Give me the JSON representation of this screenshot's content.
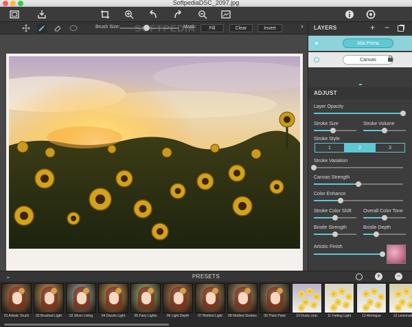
{
  "window": {
    "title": "SoftpediaDSC_2097.jpg",
    "traffic_colors": [
      "#fc605c",
      "#fdbc40",
      "#34c84a"
    ]
  },
  "toolbar": {
    "icons": [
      "open-image-icon",
      "import-icon",
      "crop-icon",
      "zoom-in-icon",
      "undo-icon",
      "redo-icon",
      "zoom-out-icon",
      "fit-screen-icon",
      "info-icon",
      "settings-icon"
    ]
  },
  "subbar": {
    "brush_size_label": "Brush Size:",
    "brush_size_value": 0.45,
    "mask_label": "Mask:",
    "fill_label": "Fill",
    "clear_label": "Clear",
    "invert_label": "Invert",
    "collapse_label": "›"
  },
  "watermark": "SOFTPEDIA",
  "layers": {
    "title": "LAYERS",
    "add_label": "+",
    "remove_label": "−",
    "items": [
      {
        "name": "Alla Prima",
        "selected": true
      },
      {
        "name": "Canvas",
        "selected": false,
        "locked": true
      }
    ]
  },
  "adjust": {
    "title": "ADJUST",
    "layer_opacity": {
      "label": "Layer Opacity",
      "value": 1.0
    },
    "stroke_size": {
      "label": "Stroke Size",
      "value": 0.45
    },
    "stroke_volume": {
      "label": "Stroke Volume",
      "value": 0.5
    },
    "stroke_style": {
      "label": "Stroke Style",
      "options": [
        "1",
        "2",
        "3"
      ],
      "selected": "2"
    },
    "stroke_variation": {
      "label": "Stroke Variation",
      "value": 0.0
    },
    "canvas_strength": {
      "label": "Canvas Strength",
      "value": 0.5
    },
    "color_enhance": {
      "label": "Color Enhance",
      "value": 0.3
    },
    "stroke_color_shift": {
      "label": "Stroke Color Shift",
      "value": 0.5
    },
    "overall_color_tone": {
      "label": "Overall Color Tone",
      "value": 0.5
    },
    "bristle_strength": {
      "label": "Bristle Strength",
      "value": 0.5
    },
    "bristle_depth": {
      "label": "Bristle Depth",
      "value": 0.3
    },
    "artistic_finish": {
      "label": "Artistic Finish",
      "value": 1.0
    }
  },
  "presets": {
    "title": "PRESETS",
    "add_label": "+",
    "remove_label": "−",
    "items": [
      {
        "name": "01 Artistic Touch",
        "kind": "portrait",
        "tint": "#7a5a3a"
      },
      {
        "name": "02 Brushed Light",
        "kind": "portrait",
        "tint": "#8a6a40"
      },
      {
        "name": "03 Silver Lining",
        "kind": "portrait",
        "tint": "#6f7470"
      },
      {
        "name": "04 Dazzle Light",
        "kind": "portrait",
        "tint": "#8a6d3e"
      },
      {
        "name": "05 Fairy Lights",
        "kind": "portrait",
        "tint": "#6f7a52"
      },
      {
        "name": "06 Light Depth",
        "kind": "portrait",
        "tint": "#7e5a3c"
      },
      {
        "name": "07 Mottled Light",
        "kind": "portrait",
        "tint": "#7a6248"
      },
      {
        "name": "08 Mottled Strokes",
        "kind": "portrait",
        "tint": "#7a6a4e"
      },
      {
        "name": "09 Thick Paint",
        "kind": "portrait",
        "tint": "#6e6448"
      },
      {
        "name": "10 Dusty Lilac",
        "kind": "flowers",
        "tint": "#b9b0c4"
      },
      {
        "name": "11 Fading Light",
        "kind": "flowers",
        "tint": "#d8d2c0"
      },
      {
        "name": "12 Meringue",
        "kind": "flowers",
        "tint": "#cfd3d6"
      },
      {
        "name": "13 Lemonade",
        "kind": "flowers",
        "tint": "#d6cfa4"
      }
    ]
  }
}
